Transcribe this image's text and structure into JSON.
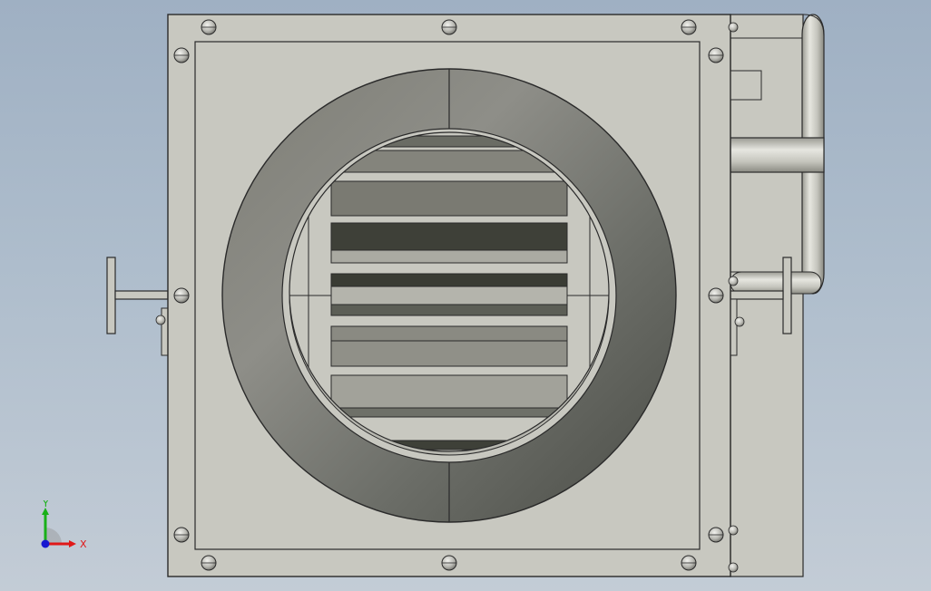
{
  "view": {
    "colors": {
      "background_top": "#9fb0c3",
      "background_bottom": "#c3ccd6",
      "housing": "#c8c8c0",
      "outline": "#2a2a2a",
      "ring_light": "#8e8e88",
      "ring_dark": "#4e504a",
      "slat_dark": "#3e4038"
    }
  },
  "triad": {
    "x_label": "X",
    "y_label": "Y",
    "x_color": "#e01818",
    "y_color": "#18b018",
    "z_color": "#1818d0"
  }
}
